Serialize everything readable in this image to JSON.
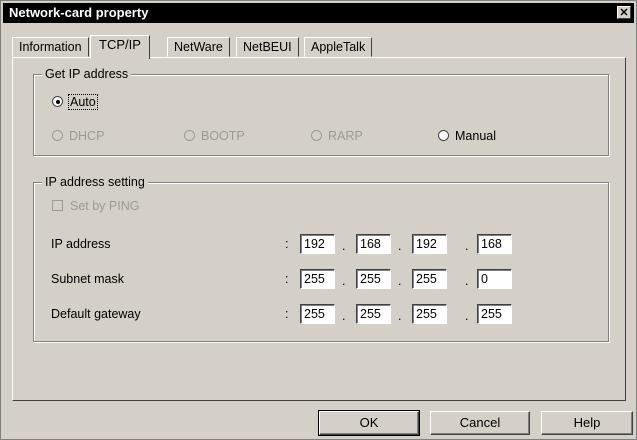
{
  "window": {
    "title": "Network-card property",
    "close_glyph": "✕"
  },
  "tabs": [
    {
      "label": "Information",
      "active": false
    },
    {
      "label": "TCP/IP",
      "active": true
    },
    {
      "label": "NetWare",
      "active": false
    },
    {
      "label": "NetBEUI",
      "active": false
    },
    {
      "label": "AppleTalk",
      "active": false
    }
  ],
  "get_ip": {
    "legend": "Get IP address",
    "auto_label": "Auto",
    "dhcp_label": "DHCP",
    "bootp_label": "BOOTP",
    "rarp_label": "RARP",
    "manual_label": "Manual",
    "selected": "Auto"
  },
  "ip_setting": {
    "legend": "IP address setting",
    "ping_label": "Set by PING",
    "colon": ":",
    "dot": ".",
    "rows": [
      {
        "label": "IP address",
        "octets": [
          "192",
          "168",
          "192",
          "168"
        ]
      },
      {
        "label": "Subnet mask",
        "octets": [
          "255",
          "255",
          "255",
          "0"
        ]
      },
      {
        "label": "Default gateway",
        "octets": [
          "255",
          "255",
          "255",
          "255"
        ]
      }
    ]
  },
  "buttons": {
    "ok": "OK",
    "cancel": "Cancel",
    "help": "Help"
  }
}
